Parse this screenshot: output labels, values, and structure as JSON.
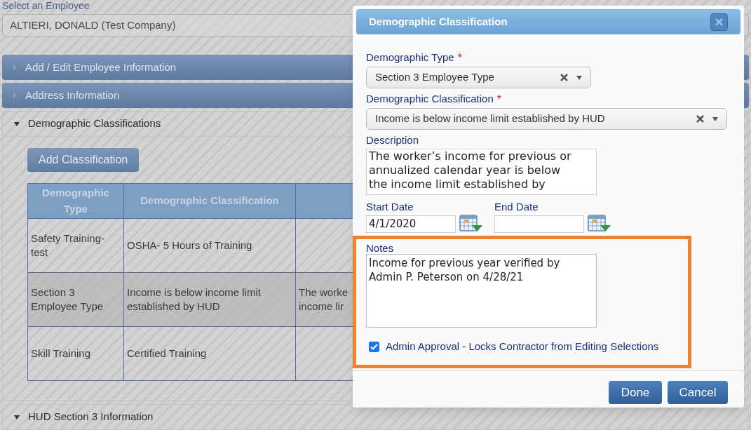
{
  "employee_select": {
    "label": "Select an Employee",
    "value": "ALTIERI, DONALD (Test Company)"
  },
  "sections": [
    {
      "title": "Add / Edit Employee Information",
      "expanded": false
    },
    {
      "title": "Address Information",
      "expanded": false
    },
    {
      "title": "Demographic Classifications",
      "expanded": true
    },
    {
      "title": "HUD Section 3 Information",
      "expanded": true
    }
  ],
  "classifications": {
    "add_button": "Add Classification",
    "columns": [
      "Demographic Type",
      "Demographic Classification"
    ],
    "rows": [
      {
        "cells": [
          "Safety Training-test",
          "OSHA- 5 Hours of Training",
          ""
        ],
        "selected": false
      },
      {
        "cells": [
          "Section 3 Employee Type",
          "Income is below income limit established by HUD",
          "The worke\nincome lir"
        ],
        "selected": true
      },
      {
        "cells": [
          "Skill Training",
          "Certified Training",
          ""
        ],
        "selected": false
      }
    ]
  },
  "dialog": {
    "title": "Demographic Classification",
    "demographic_type": {
      "label": "Demographic Type",
      "required_mark": "*",
      "value": "Section 3 Employee Type"
    },
    "demographic_classification": {
      "label": "Demographic Classification",
      "required_mark": "*",
      "value": "Income is below income limit established by HUD"
    },
    "description": {
      "label": "Description",
      "value": "The worker’s income for previous or annualized calendar year is below the income limit established by"
    },
    "start_date": {
      "label": "Start Date",
      "value": "4/1/2020"
    },
    "end_date": {
      "label": "End Date"
    },
    "notes": {
      "label": "Notes",
      "value": "Income for previous year verified by Admin P. Peterson on 4/28/21"
    },
    "admin_approval": {
      "label": "Admin Approval - Locks Contractor from Editing Selections",
      "checked": true
    },
    "buttons": [
      "Done",
      "Cancel"
    ]
  }
}
